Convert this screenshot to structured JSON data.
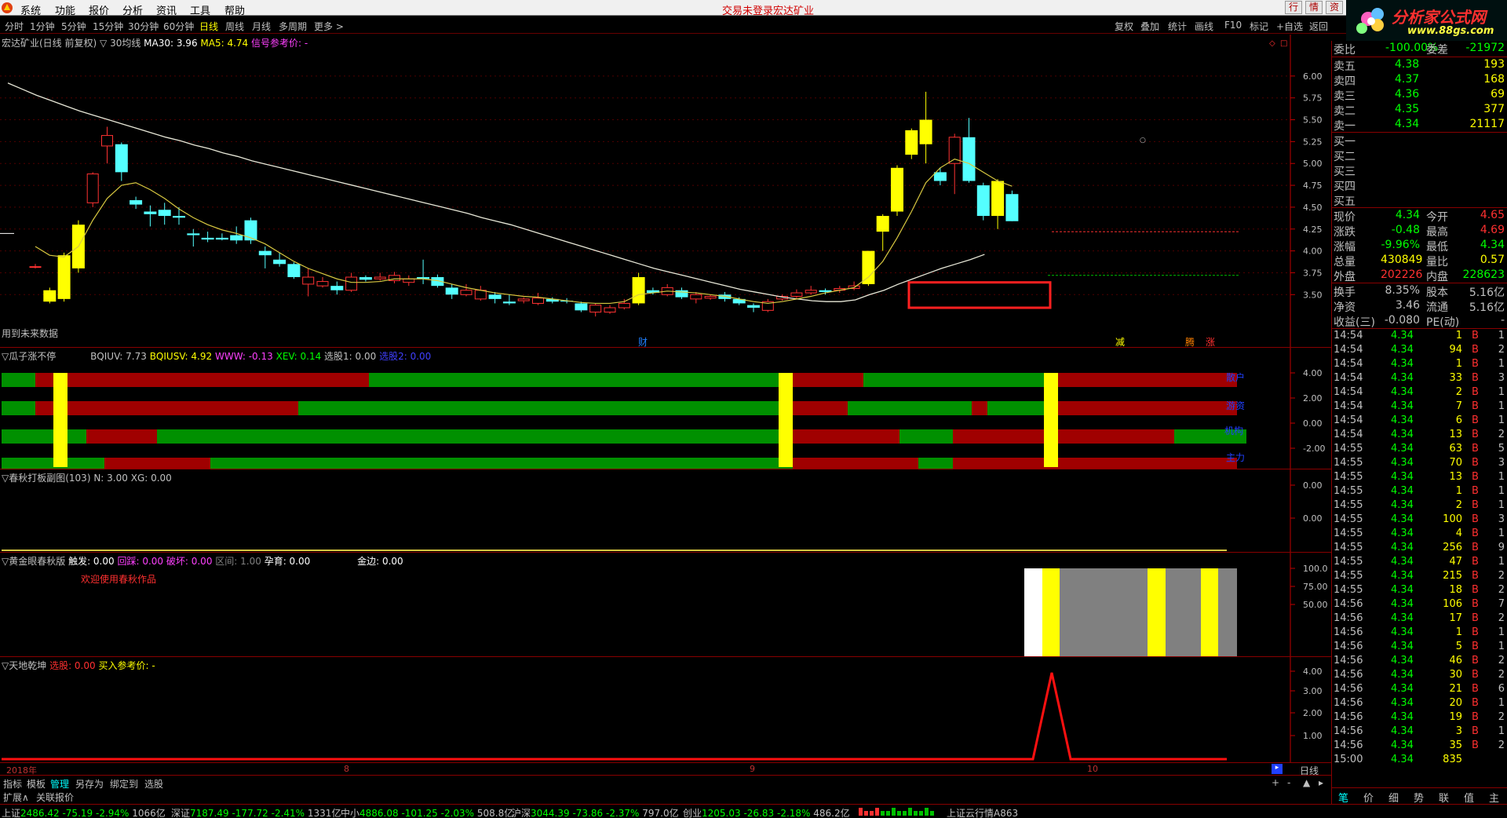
{
  "menu": {
    "items": [
      "系统",
      "功能",
      "报价",
      "分析",
      "资讯",
      "工具",
      "帮助"
    ],
    "status": "交易未登录",
    "stock_link": "宏达矿业",
    "window_buttons": [
      "行",
      "情",
      "资"
    ]
  },
  "brand": {
    "name": "分析家公式网",
    "url": "www.88gs.com"
  },
  "periods": [
    "分时",
    "1分钟",
    "5分钟",
    "15分钟",
    "30分钟",
    "60分钟",
    "日线",
    "周线",
    "月线",
    "多周期",
    "更多 >"
  ],
  "active_period": "日线",
  "tools": [
    "复权",
    "叠加",
    "统计",
    "画线",
    "F10",
    "标记",
    "+自选",
    "返回"
  ],
  "main": {
    "title": "宏达矿业(日线 前复权) ▽",
    "ma30_name": "30均线",
    "ma30_label": "MA30: 3.96",
    "ma5_label": "MA5: 4.74",
    "signal": "信号参考价: -",
    "no_future": "用到未来数据",
    "events": [
      "财",
      "减",
      "腾",
      "涨"
    ],
    "yticks": [
      "6.00",
      "5.75",
      "5.50",
      "5.25",
      "5.00",
      "4.75",
      "4.50",
      "4.25",
      "4.00",
      "3.75",
      "3.50"
    ]
  },
  "ind1": {
    "title": "▽瓜子涨不停",
    "vals": [
      "BQIUV: 7.73",
      "BQIUSV: 4.92",
      "WWW: -0.13",
      "XEV: 0.14",
      "选股1: 0.00",
      "选股2: 0.00"
    ],
    "labels": [
      "散户",
      "游资",
      "机构",
      "主力"
    ],
    "yticks": [
      "4.00",
      "2.00",
      "0.00",
      "-2.00"
    ]
  },
  "ind2": {
    "title": "▽春秋打板副图(103)",
    "vals": [
      "N: 3.00",
      "XG: 0.00"
    ],
    "yticks": [
      "0.00",
      "0.00"
    ]
  },
  "ind3": {
    "title": "▽黄金眼春秋版",
    "vals": [
      "触发: 0.00",
      "回踩: 0.00",
      "破坏: 0.00",
      "区间: 1.00",
      "孕育: 0.00",
      "金边: 0.00"
    ],
    "welcome": "欢迎使用春秋作品",
    "yticks": [
      "100.0",
      "75.00",
      "50.00"
    ]
  },
  "ind4": {
    "title": "▽天地乾坤",
    "vals": [
      "选股: 0.00",
      "买入参考价: -"
    ],
    "yticks": [
      "4.00",
      "3.00",
      "2.00",
      "1.00"
    ]
  },
  "xaxis": {
    "labels": [
      "2018年",
      "8",
      "9",
      "10"
    ],
    "period": "日线"
  },
  "tabs1": [
    "指标",
    "模板",
    "管理",
    "另存为",
    "绑定到",
    "选股"
  ],
  "tabs2": [
    "扩展∧",
    "关联报价"
  ],
  "quote": {
    "weibi": {
      "label": "委比",
      "value": "-100.00%",
      "label2": "委差",
      "value2": "-21972"
    },
    "sells": [
      {
        "label": "卖五",
        "price": "4.38",
        "vol": "193"
      },
      {
        "label": "卖四",
        "price": "4.37",
        "vol": "168"
      },
      {
        "label": "卖三",
        "price": "4.36",
        "vol": "69"
      },
      {
        "label": "卖二",
        "price": "4.35",
        "vol": "377"
      },
      {
        "label": "卖一",
        "price": "4.34",
        "vol": "21117"
      }
    ],
    "buys": [
      "买一",
      "买二",
      "买三",
      "买四",
      "买五"
    ],
    "stats": [
      {
        "l1": "现价",
        "v1": "4.34",
        "l2": "今开",
        "v2": "4.65"
      },
      {
        "l1": "涨跌",
        "v1": "-0.48",
        "l2": "最高",
        "v2": "4.69"
      },
      {
        "l1": "涨幅",
        "v1": "-9.96%",
        "l2": "最低",
        "v2": "4.34"
      },
      {
        "l1": "总量",
        "v1": "430849",
        "l2": "量比",
        "v2": "0.57"
      },
      {
        "l1": "外盘",
        "v1": "202226",
        "l2": "内盘",
        "v2": "228623"
      },
      {
        "l1": "换手",
        "v1": "8.35%",
        "l2": "股本",
        "v2": "5.16亿"
      },
      {
        "l1": "净资",
        "v1": "3.46",
        "l2": "流通",
        "v2": "5.16亿"
      },
      {
        "l1": "收益(三)",
        "v1": "-0.080",
        "l2": "PE(动)",
        "v2": "-"
      }
    ],
    "ticks": [
      [
        "14:54",
        "4.34",
        "1",
        "B",
        "1"
      ],
      [
        "14:54",
        "4.34",
        "94",
        "B",
        "2"
      ],
      [
        "14:54",
        "4.34",
        "1",
        "B",
        "1"
      ],
      [
        "14:54",
        "4.34",
        "33",
        "B",
        "3"
      ],
      [
        "14:54",
        "4.34",
        "2",
        "B",
        "1"
      ],
      [
        "14:54",
        "4.34",
        "7",
        "B",
        "1"
      ],
      [
        "14:54",
        "4.34",
        "6",
        "B",
        "1"
      ],
      [
        "14:54",
        "4.34",
        "13",
        "B",
        "2"
      ],
      [
        "14:55",
        "4.34",
        "63",
        "B",
        "5"
      ],
      [
        "14:55",
        "4.34",
        "70",
        "B",
        "3"
      ],
      [
        "14:55",
        "4.34",
        "13",
        "B",
        "1"
      ],
      [
        "14:55",
        "4.34",
        "1",
        "B",
        "1"
      ],
      [
        "14:55",
        "4.34",
        "2",
        "B",
        "1"
      ],
      [
        "14:55",
        "4.34",
        "100",
        "B",
        "3"
      ],
      [
        "14:55",
        "4.34",
        "4",
        "B",
        "1"
      ],
      [
        "14:55",
        "4.34",
        "256",
        "B",
        "9"
      ],
      [
        "14:55",
        "4.34",
        "47",
        "B",
        "1"
      ],
      [
        "14:55",
        "4.34",
        "215",
        "B",
        "2"
      ],
      [
        "14:55",
        "4.34",
        "18",
        "B",
        "2"
      ],
      [
        "14:56",
        "4.34",
        "106",
        "B",
        "7"
      ],
      [
        "14:56",
        "4.34",
        "17",
        "B",
        "2"
      ],
      [
        "14:56",
        "4.34",
        "1",
        "B",
        "1"
      ],
      [
        "14:56",
        "4.34",
        "5",
        "B",
        "1"
      ],
      [
        "14:56",
        "4.34",
        "46",
        "B",
        "2"
      ],
      [
        "14:56",
        "4.34",
        "30",
        "B",
        "2"
      ],
      [
        "14:56",
        "4.34",
        "21",
        "B",
        "6"
      ],
      [
        "14:56",
        "4.34",
        "20",
        "B",
        "1"
      ],
      [
        "14:56",
        "4.34",
        "19",
        "B",
        "2"
      ],
      [
        "14:56",
        "4.34",
        "3",
        "B",
        "1"
      ],
      [
        "14:56",
        "4.34",
        "35",
        "B",
        "2"
      ],
      [
        "15:00",
        "4.34",
        "835",
        "",
        ""
      ]
    ],
    "bottom_tabs": [
      "笔",
      "价",
      "细",
      "势",
      "联",
      "值",
      "主"
    ]
  },
  "status": [
    {
      "name": "上证",
      "val": "2486.42",
      "chg": "-75.19",
      "pct": "-2.94%",
      "amt": "1066亿"
    },
    {
      "name": "深证",
      "val": "7187.49",
      "chg": "-177.72",
      "pct": "-2.41%",
      "amt": "1331亿"
    },
    {
      "name": "中小",
      "val": "4886.08",
      "chg": "-101.25",
      "pct": "-2.03%",
      "amt": "508.8亿"
    },
    {
      "name": "沪深",
      "val": "3044.39",
      "chg": "-73.86",
      "pct": "-2.37%",
      "amt": "797.0亿"
    },
    {
      "name": "创业",
      "val": "1205.03",
      "chg": "-26.83",
      "pct": "-2.18%",
      "amt": "486.2亿"
    }
  ],
  "status_extra": "上证云行情A863",
  "colors": {
    "up": "#ff3232",
    "down": "#54ffff",
    "yellow": "#ffff00",
    "green": "#00a000",
    "darkred": "#a00000"
  }
}
